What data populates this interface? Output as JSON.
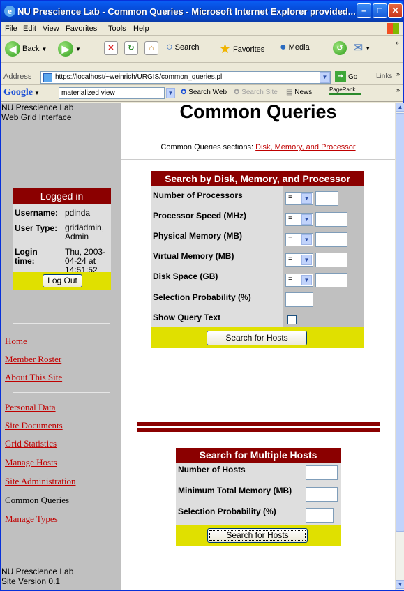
{
  "window": {
    "title": "NU Prescience Lab - Common Queries - Microsoft Internet Explorer provided..."
  },
  "menu": [
    "File",
    "Edit",
    "View",
    "Favorites",
    "Tools",
    "Help"
  ],
  "toolbar": {
    "back": "Back",
    "search": "Search",
    "favorites": "Favorites",
    "media": "Media"
  },
  "address": {
    "label": "Address",
    "url": "https://localhost/~weinrich/URGIS/common_queries.pl",
    "go": "Go",
    "links": "Links"
  },
  "googlebar": {
    "brand": "Google",
    "query": "materialized view",
    "search_web": "Search Web",
    "search_site": "Search Site",
    "news": "News",
    "pagerank": "PageRank"
  },
  "sidebar": {
    "site_name_1": "NU Prescience Lab",
    "site_name_2": "Web Grid Interface",
    "login": {
      "heading": "Logged in",
      "username_label": "Username:",
      "username": "pdinda",
      "usertype_label": "User Type:",
      "usertype": "gridadmin, Admin",
      "logintime_label": "Login time:",
      "logintime": "Thu, 2003-04-24 at 14:51:52",
      "logout": "Log Out"
    },
    "nav1": [
      "Home",
      "Member Roster",
      "About This Site"
    ],
    "nav2": [
      "Personal Data",
      "Site Documents",
      "Grid Statistics",
      "Manage Hosts",
      "Site Administration"
    ],
    "current": "Common Queries",
    "nav3": [
      "Manage Types"
    ],
    "footer_1": "NU Prescience Lab",
    "footer_2": "Site Version 0.1"
  },
  "main": {
    "title": "Common Queries",
    "sections_label": "Common Queries sections:",
    "sections_link": "Disk, Memory, and Processor",
    "form1": {
      "heading": "Search by Disk, Memory, and Processor",
      "rows": [
        {
          "label": "Number of Processors",
          "op": "="
        },
        {
          "label": "Processor Speed (MHz)",
          "op": "="
        },
        {
          "label": "Physical Memory (MB)",
          "op": "="
        },
        {
          "label": "Virtual Memory (MB)",
          "op": "="
        },
        {
          "label": "Disk Space (GB)",
          "op": "="
        }
      ],
      "probability": "Selection Probability (%)",
      "show_query": "Show Query Text",
      "button": "Search for Hosts"
    },
    "form2": {
      "heading": "Search for Multiple Hosts",
      "rows": [
        "Number of Hosts",
        "Minimum Total Memory (MB)",
        "Selection Probability (%)"
      ],
      "button": "Search for Hosts"
    }
  }
}
